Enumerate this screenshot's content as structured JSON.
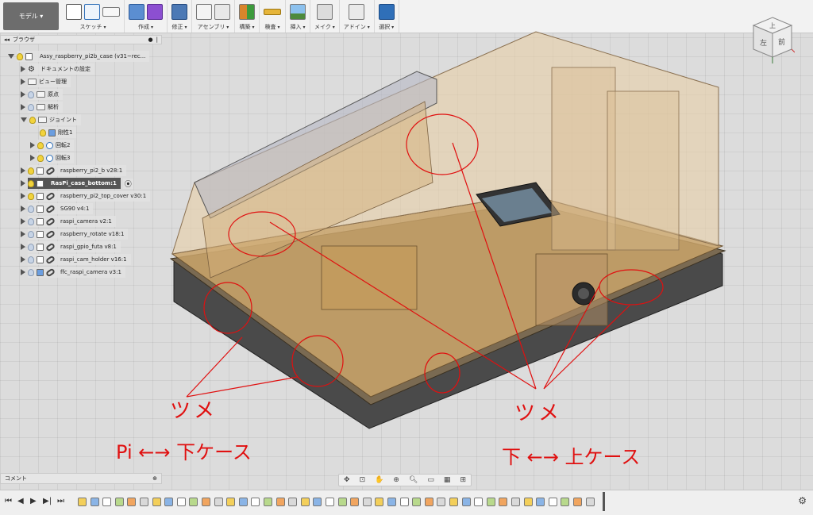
{
  "toolbar": {
    "workspace": "モデル ▾",
    "groups": [
      {
        "label": "スケッチ"
      },
      {
        "label": "作成"
      },
      {
        "label": "修正"
      },
      {
        "label": "アセンブリ"
      },
      {
        "label": "構築"
      },
      {
        "label": "検査"
      },
      {
        "label": "挿入"
      },
      {
        "label": "メイク"
      },
      {
        "label": "アドイン"
      },
      {
        "label": "選択"
      }
    ]
  },
  "browser": {
    "title": "ブラウザ",
    "items": [
      {
        "label": "Assy_raspberry_pi2b_case (v31~rec..."
      },
      {
        "label": "ドキュメントの設定"
      },
      {
        "label": "ビュー管理"
      },
      {
        "label": "原点"
      },
      {
        "label": "解析"
      },
      {
        "label": "ジョイント"
      },
      {
        "label": "剛性1"
      },
      {
        "label": "回転2"
      },
      {
        "label": "回転3"
      },
      {
        "label": "raspberry_pi2_b v28:1"
      },
      {
        "label": "RasPi_case_bottom:1"
      },
      {
        "label": "raspberry_pi2_top_cover v30:1"
      },
      {
        "label": "SG90 v4:1"
      },
      {
        "label": "raspi_camera v2:1"
      },
      {
        "label": "raspberry_rotate v18:1"
      },
      {
        "label": "raspi_gpio_futa v8:1"
      },
      {
        "label": "raspi_cam_holder v16:1"
      },
      {
        "label": "ffc_raspi_camera v3:1"
      }
    ]
  },
  "viewcube": {
    "top": "上",
    "front": "前",
    "left": "左"
  },
  "annotations": {
    "left_mark": "ツメ",
    "left_caption": "Pi ←→ 下ケース",
    "right_mark": "ツメ",
    "right_caption": "下 ←→ 上ケース",
    "color": "#e01010"
  },
  "comment": {
    "label": "コメント"
  },
  "timeline": {
    "step_count": 42
  }
}
